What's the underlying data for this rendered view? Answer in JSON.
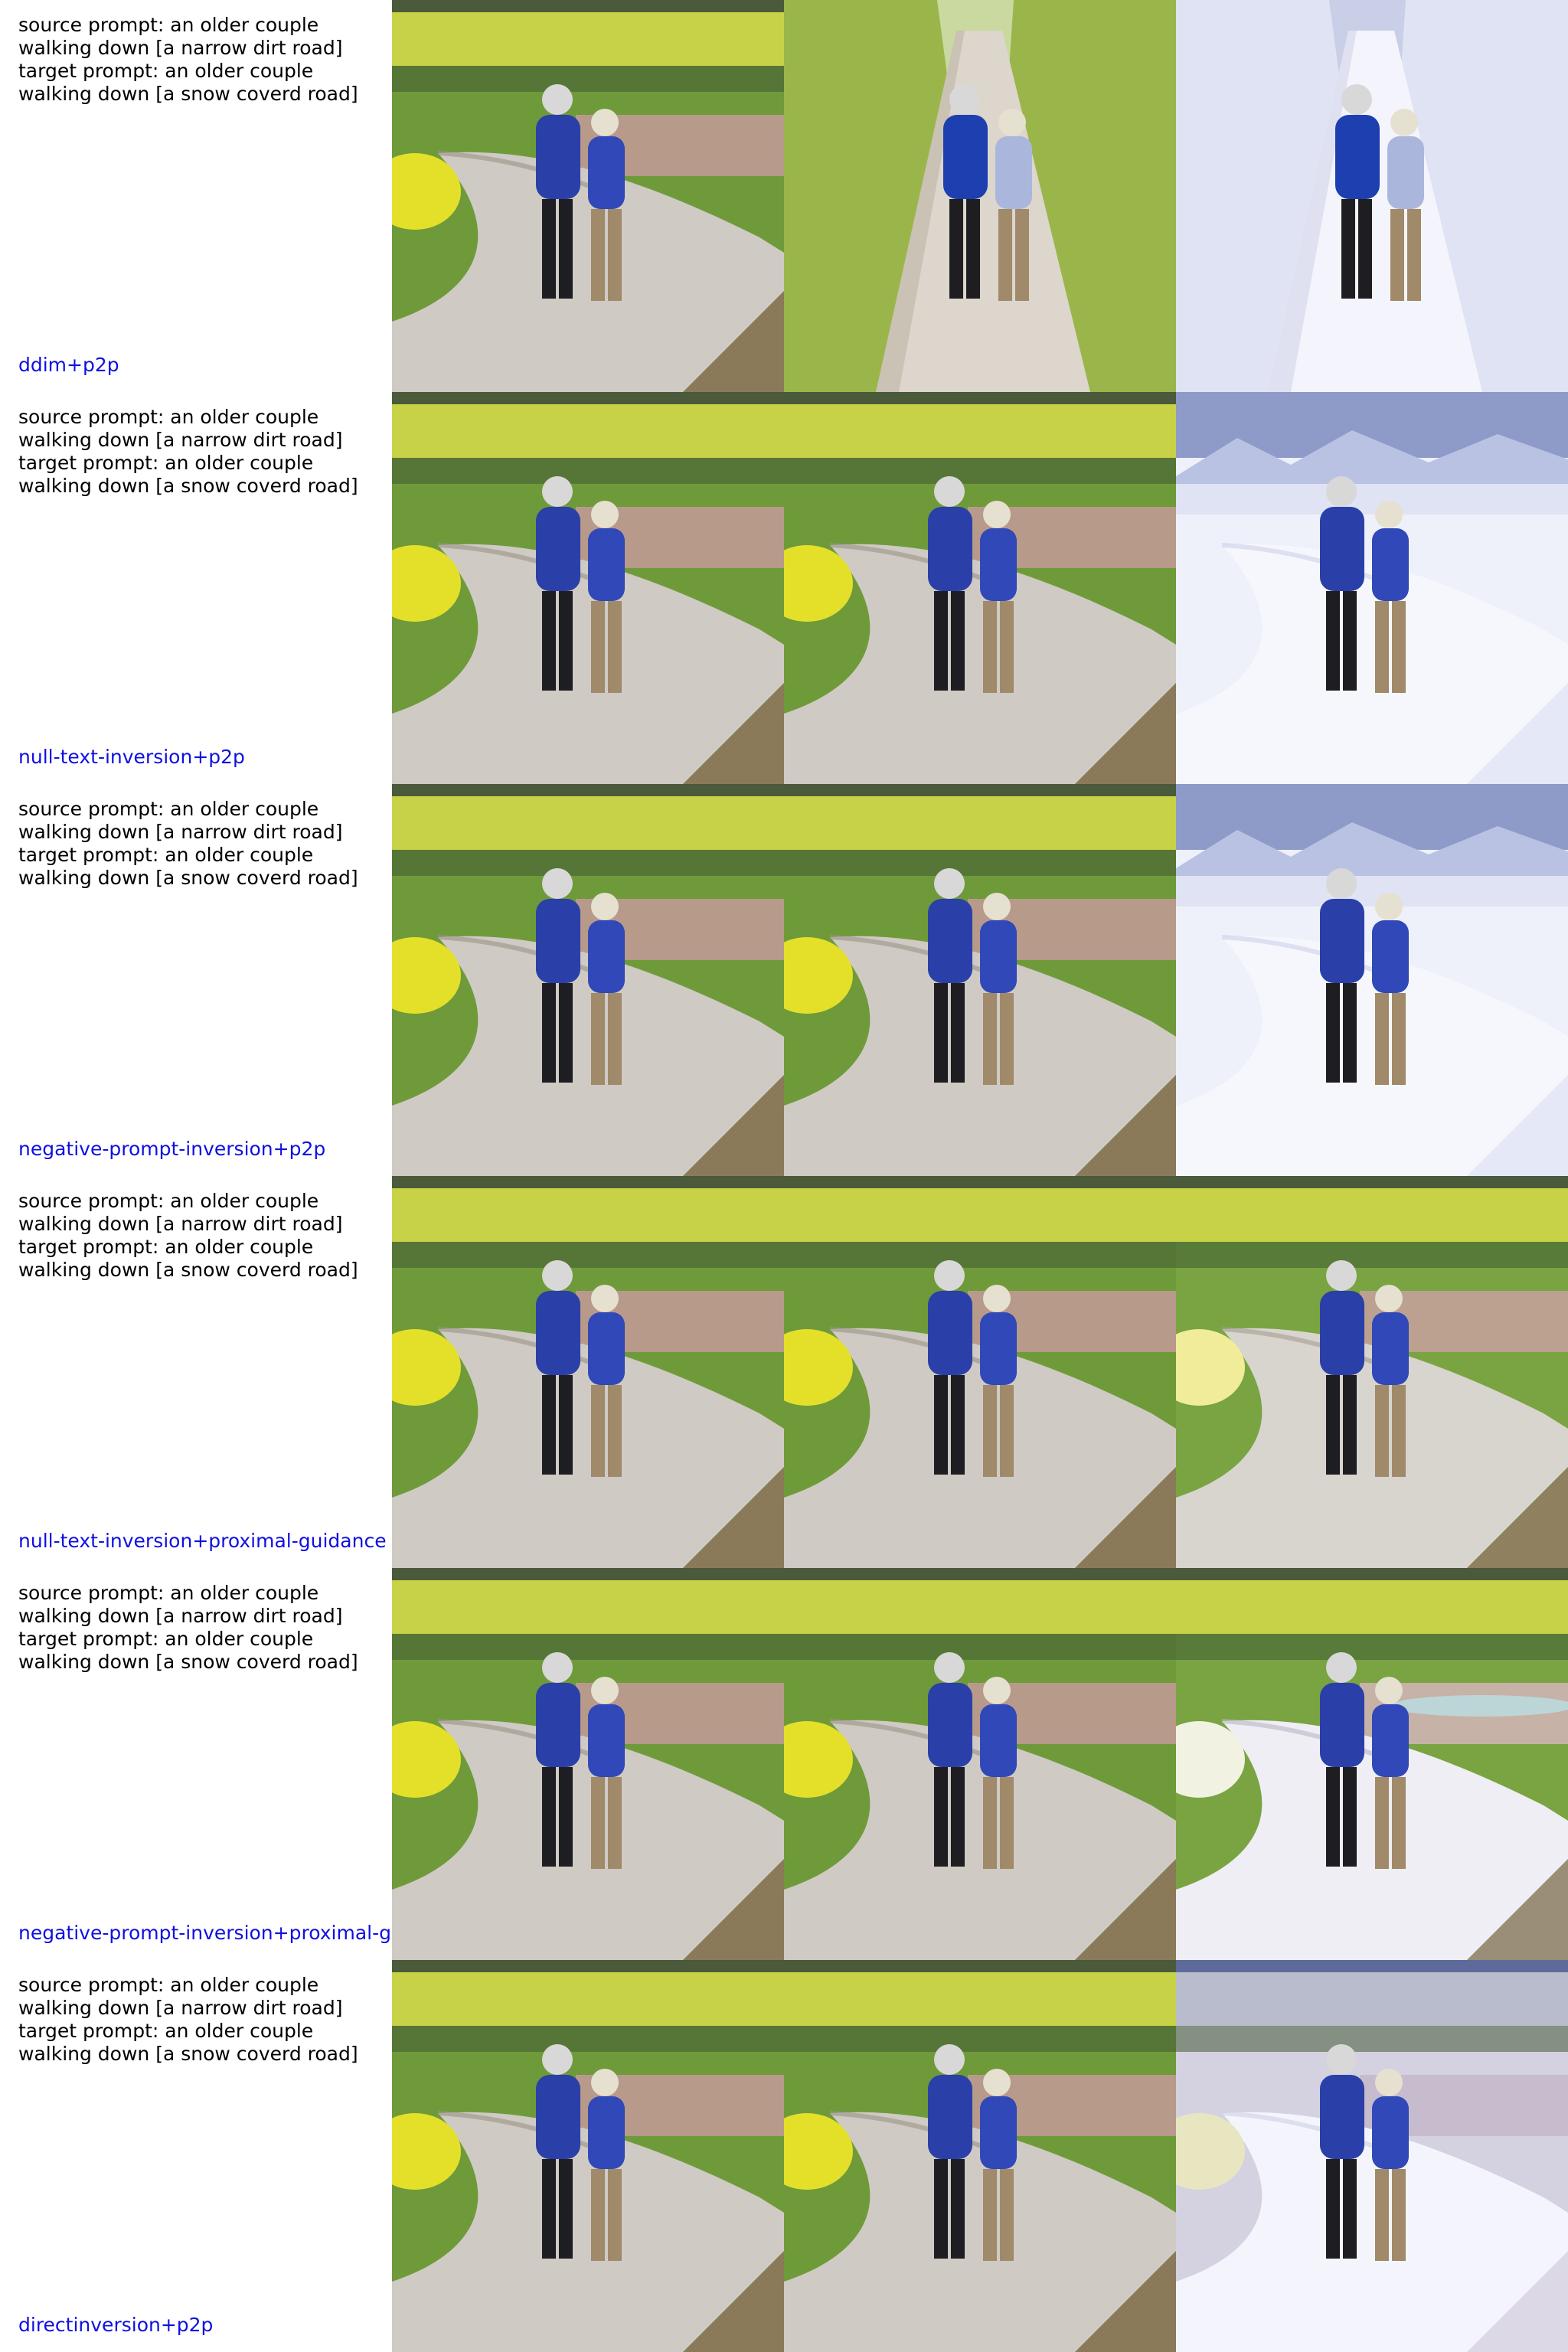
{
  "rows": [
    {
      "method": "ddim+p2p",
      "prompt": "source prompt: an older couple\nwalking down [a narrow dirt road]\ntarget prompt: an older couple\nwalking down [a snow coverd road]",
      "images": [
        {
          "kind": "source",
          "scene": "dirt"
        },
        {
          "kind": "reconstruction",
          "scene": "lane"
        },
        {
          "kind": "edit",
          "scene": "snowlane"
        }
      ]
    },
    {
      "method": "null-text-inversion+p2p",
      "prompt": "source prompt: an older couple\nwalking down [a narrow dirt road]\ntarget prompt: an older couple\nwalking down [a snow coverd road]",
      "images": [
        {
          "kind": "source",
          "scene": "dirt"
        },
        {
          "kind": "reconstruction",
          "scene": "dirt"
        },
        {
          "kind": "edit",
          "scene": "snowmountain"
        }
      ]
    },
    {
      "method": "negative-prompt-inversion+p2p",
      "prompt": "source prompt: an older couple\nwalking down [a narrow dirt road]\ntarget prompt: an older couple\nwalking down [a snow coverd road]",
      "images": [
        {
          "kind": "source",
          "scene": "dirt"
        },
        {
          "kind": "reconstruction",
          "scene": "dirt"
        },
        {
          "kind": "edit",
          "scene": "snowmountain"
        }
      ]
    },
    {
      "method": "null-text-inversion+proximal-guidance",
      "prompt": "source prompt: an older couple\nwalking down [a narrow dirt road]\ntarget prompt: an older couple\nwalking down [a snow coverd road]",
      "images": [
        {
          "kind": "source",
          "scene": "dirt"
        },
        {
          "kind": "reconstruction",
          "scene": "dirt"
        },
        {
          "kind": "edit",
          "scene": "dirtlight"
        }
      ]
    },
    {
      "method": "negative-prompt-inversion+proximal-g",
      "prompt": "source prompt: an older couple\nwalking down [a narrow dirt road]\ntarget prompt: an older couple\nwalking down [a snow coverd road]",
      "images": [
        {
          "kind": "source",
          "scene": "dirt"
        },
        {
          "kind": "reconstruction",
          "scene": "dirt"
        },
        {
          "kind": "edit",
          "scene": "snowpartial"
        }
      ]
    },
    {
      "method": "directinversion+p2p",
      "prompt": "source prompt: an older couple\nwalking down [a narrow dirt road]\ntarget prompt: an older couple\nwalking down [a snow coverd road]",
      "images": [
        {
          "kind": "source",
          "scene": "dirt"
        },
        {
          "kind": "reconstruction",
          "scene": "dirt"
        },
        {
          "kind": "edit",
          "scene": "snowfield"
        }
      ]
    }
  ],
  "colors": {
    "method_label": "#1010e0",
    "prompt_text": "#000000",
    "background": "#ffffff"
  }
}
